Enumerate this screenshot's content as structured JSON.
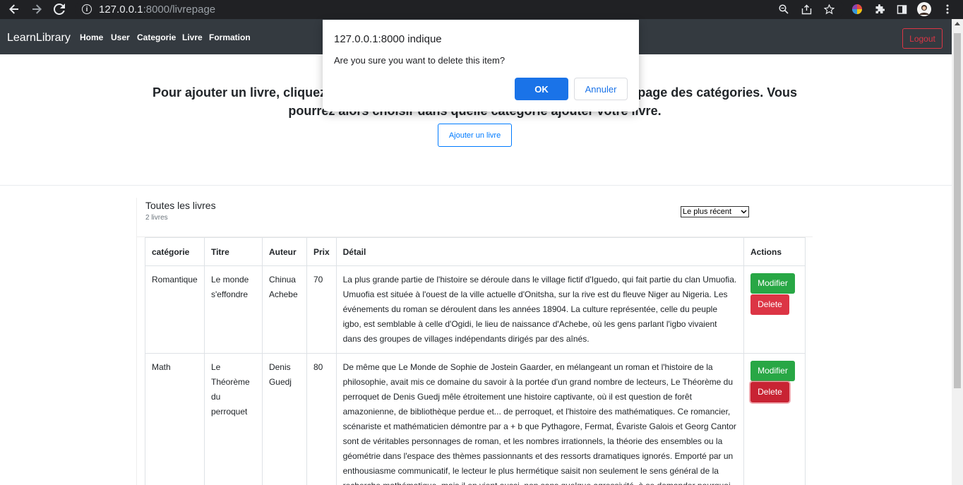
{
  "browser": {
    "url_host": "127.0.0.1",
    "url_rest": ":8000/livrepage",
    "info_icon": "info-icon",
    "back_icon": "back-arrow-icon",
    "forward_icon": "forward-arrow-icon",
    "reload_icon": "reload-icon"
  },
  "navbar": {
    "brand": "LearnLibrary",
    "links": [
      "Home",
      "User",
      "Categorie",
      "Livre",
      "Formation"
    ],
    "logout": "Logout"
  },
  "hero": {
    "line1": "Pour ajouter un livre, cliquez sur la catégorie souhaitée ci-dessous ou depuis la page des catégories. Vous",
    "line2": "pourrez alors choisir dans quelle catégorie ajouter votre livre.",
    "add_button": "Ajouter un livre"
  },
  "listing": {
    "title": "Toutes les livres",
    "count": "2 livres",
    "sort_selected": "Le plus récent"
  },
  "table": {
    "headers": [
      "catégorie",
      "Titre",
      "Auteur",
      "Prix",
      "Détail",
      "Actions"
    ],
    "rows": [
      {
        "categorie": "Romantique",
        "titre": "Le monde s'effondre",
        "auteur": "Chinua Achebe",
        "prix": "70",
        "detail": "La plus grande partie de l'histoire se déroule dans le village fictif d'Iguedo, qui fait partie du clan Umuofia. Umuofia est située à l'ouest de la ville actuelle d'Onitsha, sur la rive est du fleuve Niger au Nigeria. Les événements du roman se déroulent dans les années 18904. La culture représentée, celle du peuple igbo, est semblable à celle d'Ogidi, le lieu de naissance d'Achebe, où les gens parlant l'igbo vivaient dans des groupes de villages indépendants dirigés par des aînés.",
        "modifier": "Modifier",
        "delete": "Delete"
      },
      {
        "categorie": "Math",
        "titre": "Le Théorème du perroquet",
        "auteur": "Denis Guedj",
        "prix": "80",
        "detail": "De même que Le Monde de Sophie de Jostein Gaarder, en mélangeant un roman et l'histoire de la philosophie, avait mis ce domaine du savoir à la portée d'un grand nombre de lecteurs, Le Théorème du perroquet de Denis Guedj mêle étroitement une histoire captivante, où il est question de forêt amazonienne, de bibliothèque perdue et... de perroquet, et l'histoire des mathématiques. Ce romancier, scénariste et mathématicien démontre par a + b que Pythagore, Fermat, Évariste Galois et Georg Cantor sont de véritables personnages de roman, et les nombres irrationnels, la théorie des ensembles ou la géométrie dans l'espace des thèmes passionnants et des ressorts dramatiques ignorés. Emporté par un enthousiasme communicatif, le lecteur le plus hermétique saisit non seulement le sens général de la recherche mathématique, mais il en vient aussi, non sans quelque agressivité, à se demander pourquoi",
        "modifier": "Modifier",
        "delete": "Delete"
      }
    ]
  },
  "dialog": {
    "title": "127.0.0.1:8000 indique",
    "message": "Are you sure you want to delete this item?",
    "ok": "OK",
    "cancel": "Annuler"
  }
}
